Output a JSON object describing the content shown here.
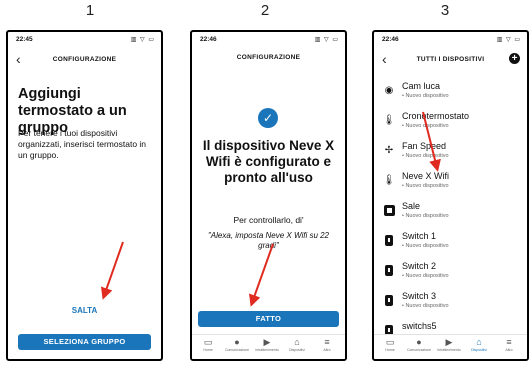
{
  "steps": [
    "1",
    "2",
    "3"
  ],
  "screen1": {
    "time": "22:45",
    "indicators": "▥ ▽ ▭",
    "title": "CONFIGURAZIONE",
    "heading": "Aggiungi termostato a un gruppo",
    "body": "Per tenere i tuoi dispositivi organizzati, inserisci termostato in un gruppo.",
    "skip_label": "SALTA",
    "select_group_label": "SELEZIONA GRUPPO"
  },
  "screen2": {
    "time": "22:46",
    "indicators": "▥ ▽ ▭",
    "title": "CONFIGURAZIONE",
    "heading": "Il dispositivo Neve X Wifi è configurato e pronto all'uso",
    "control_text": "Per controllarlo, di'",
    "quote": "\"Alexa, imposta Neve X Wifi su 22 gradi\"",
    "done_label": "FATTO"
  },
  "screen3": {
    "time": "22:46",
    "indicators": "▥ ▽ ▭",
    "title": "TUTTI I DISPOSITIVI",
    "devices": [
      {
        "name": "Cam luca",
        "status": "• Nuovo dispositivo",
        "icon": "camera-icon"
      },
      {
        "name": "Cronotermostato",
        "status": "• Nuovo dispositivo",
        "icon": "thermometer-icon"
      },
      {
        "name": "Fan Speed",
        "status": "• Nuovo dispositivo",
        "icon": "fan-icon"
      },
      {
        "name": "Neve X Wifi",
        "status": "• Nuovo dispositivo",
        "icon": "thermometer-icon"
      },
      {
        "name": "Sale",
        "status": "• Nuovo dispositivo",
        "icon": "device-icon"
      },
      {
        "name": "Switch 1",
        "status": "• Nuovo dispositivo",
        "icon": "plug-icon"
      },
      {
        "name": "Switch 2",
        "status": "• Nuovo dispositivo",
        "icon": "plug-icon"
      },
      {
        "name": "Switch 3",
        "status": "• Nuovo dispositivo",
        "icon": "plug-icon"
      },
      {
        "name": "switchs5",
        "status": "",
        "icon": "plug-icon"
      }
    ]
  },
  "bottom_nav": [
    "Home",
    "Comunicazione",
    "Intrattenimento",
    "Dispositivi",
    "Altro"
  ],
  "colors": {
    "accent": "#1a75ba",
    "arrow": "#e02b20"
  }
}
